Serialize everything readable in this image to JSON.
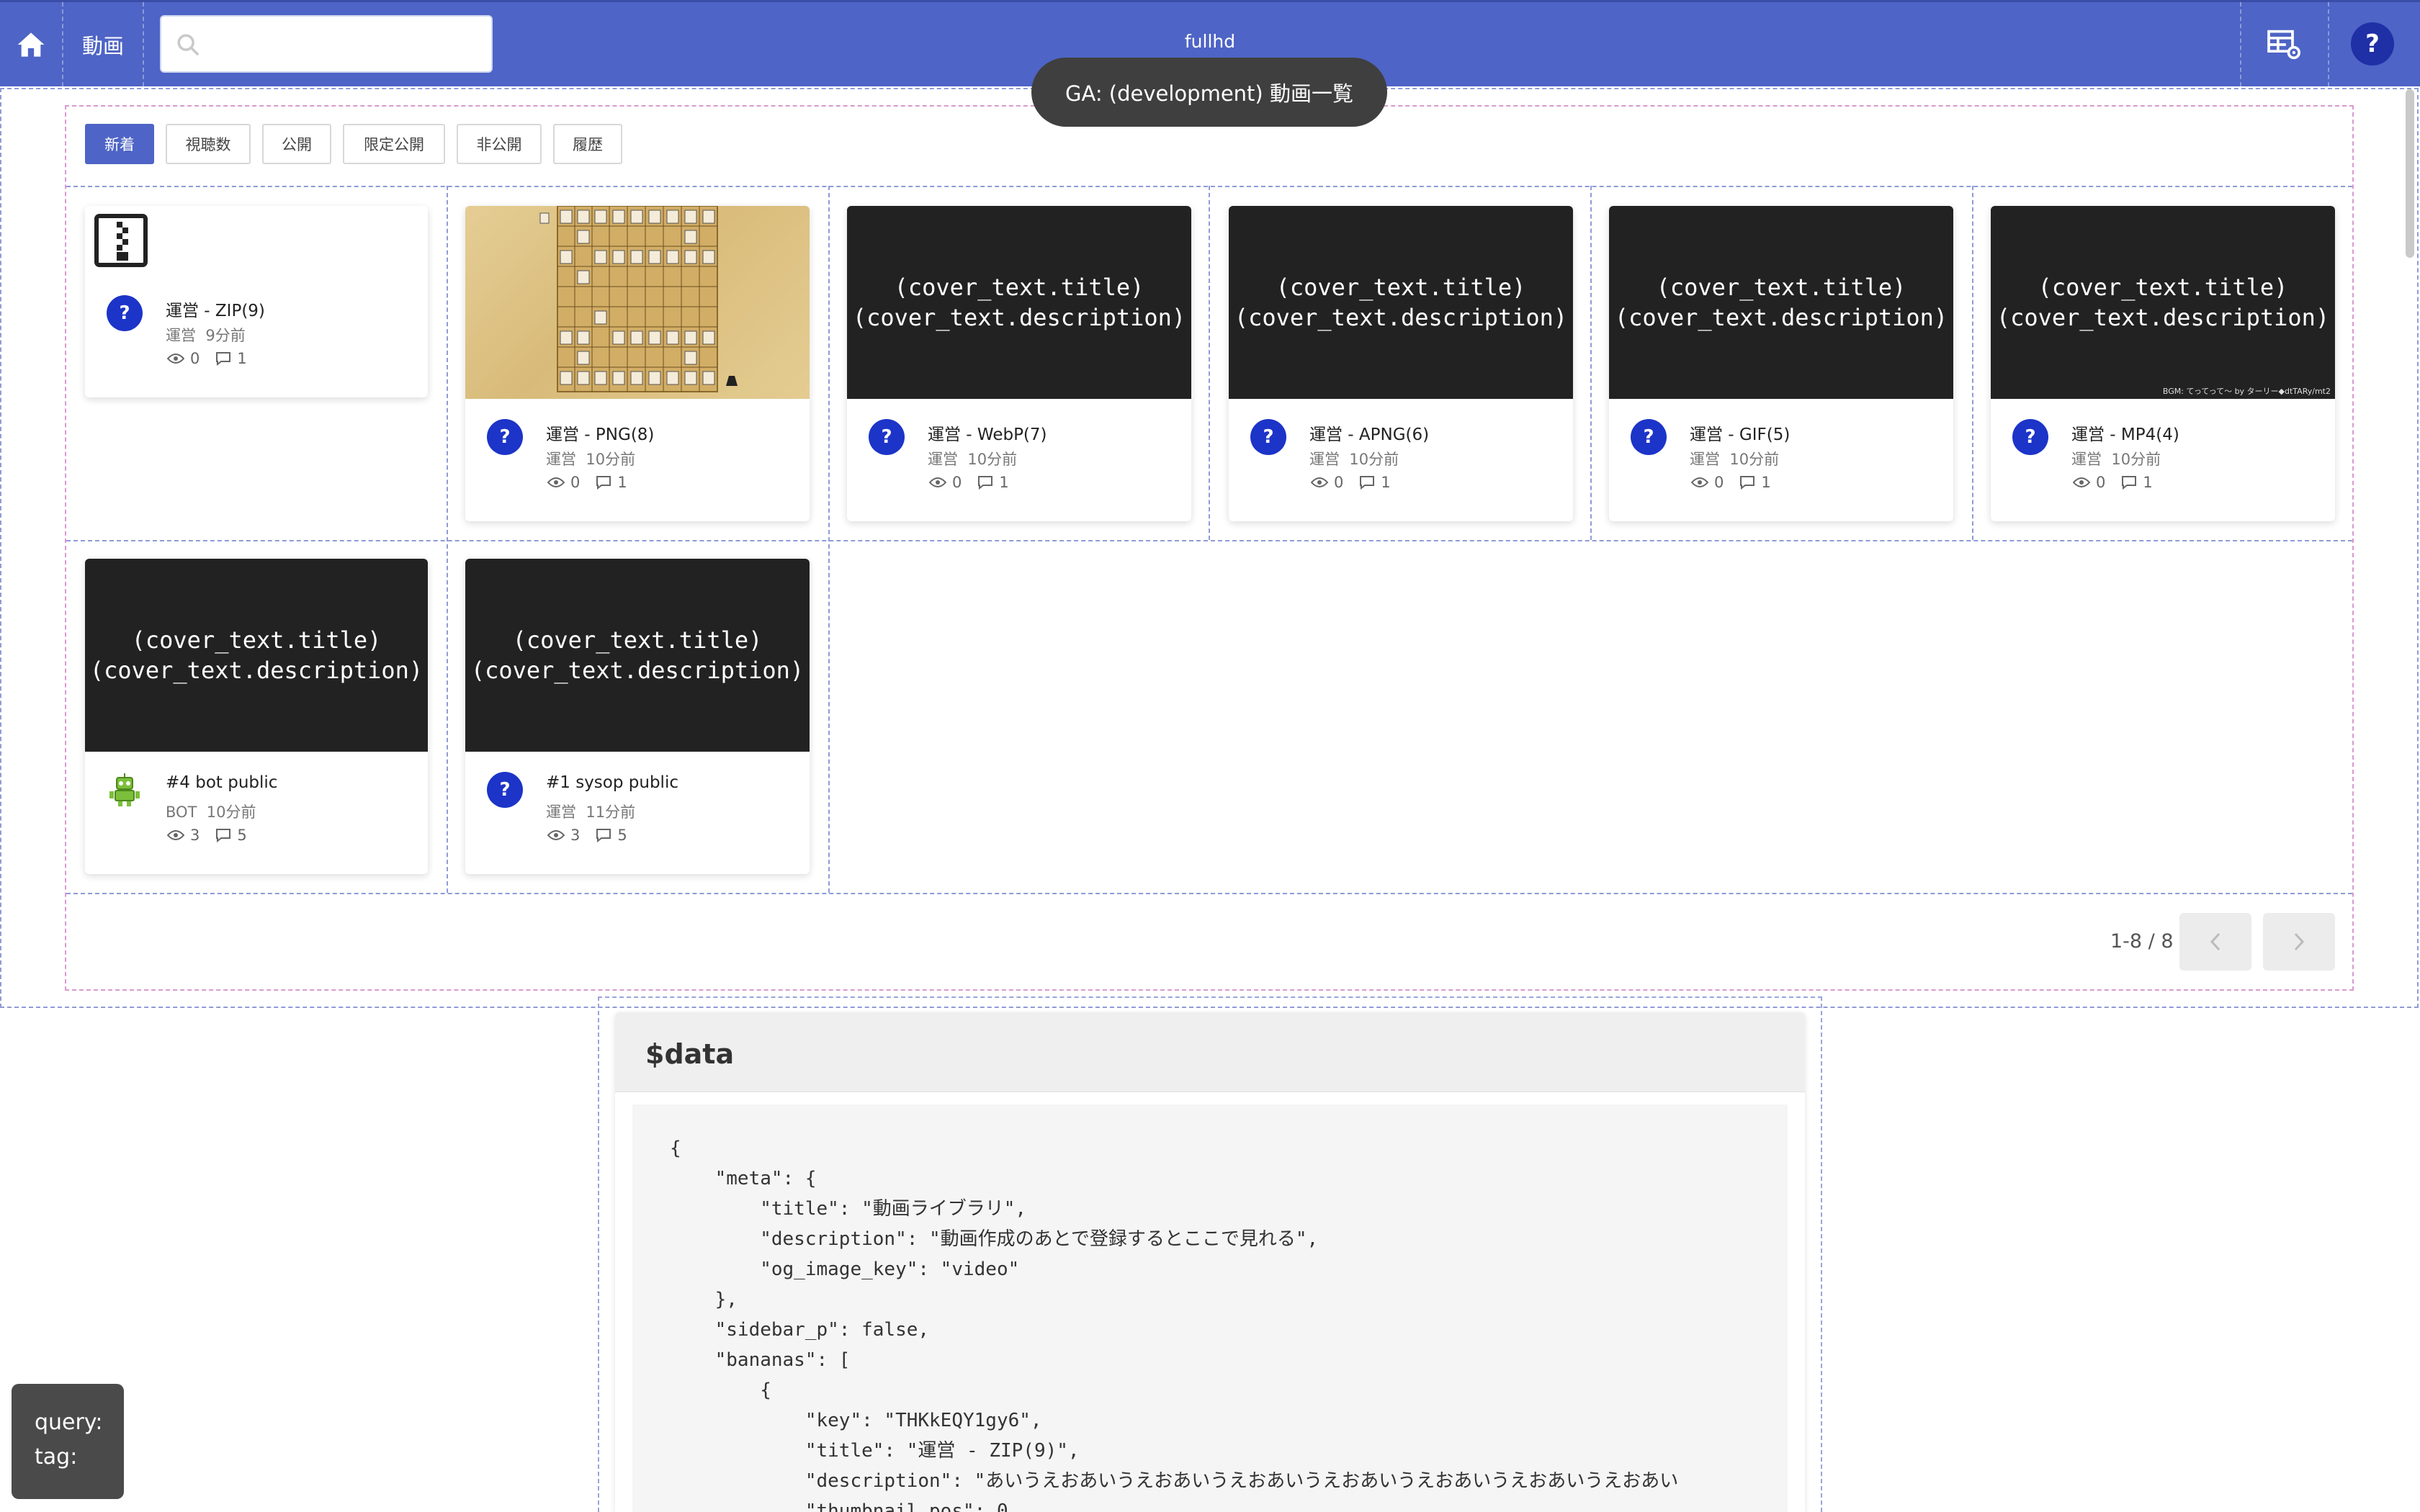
{
  "navbar": {
    "brand": "動画",
    "center_label": "fullhd",
    "search": {
      "value": "",
      "placeholder": ""
    },
    "help_label": "?"
  },
  "toast": {
    "text": "GA: (development) 動画一覧"
  },
  "tabs": [
    {
      "label": "新着",
      "active": true
    },
    {
      "label": "視聴数",
      "active": false
    },
    {
      "label": "公開",
      "active": false
    },
    {
      "label": "限定公開",
      "active": false
    },
    {
      "label": "非公開",
      "active": false
    },
    {
      "label": "履歴",
      "active": false
    }
  ],
  "cards": [
    {
      "thumb": "zip-icon",
      "title": "運営 - ZIP(9)",
      "author": "運営",
      "time": "9分前",
      "views": "0",
      "comments": "1",
      "avatar": "?"
    },
    {
      "thumb": "shogi-board",
      "title": "運営 - PNG(8)",
      "author": "運営",
      "time": "10分前",
      "views": "0",
      "comments": "1",
      "avatar": "?"
    },
    {
      "thumb": "cover",
      "cover_title": "(cover_text.title)",
      "cover_desc": "(cover_text.description)",
      "title": "運営 - WebP(7)",
      "author": "運営",
      "time": "10分前",
      "views": "0",
      "comments": "1",
      "avatar": "?"
    },
    {
      "thumb": "cover",
      "cover_title": "(cover_text.title)",
      "cover_desc": "(cover_text.description)",
      "title": "運営 - APNG(6)",
      "author": "運営",
      "time": "10分前",
      "views": "0",
      "comments": "1",
      "avatar": "?"
    },
    {
      "thumb": "cover",
      "cover_title": "(cover_text.title)",
      "cover_desc": "(cover_text.description)",
      "title": "運営 - GIF(5)",
      "author": "運営",
      "time": "10分前",
      "views": "0",
      "comments": "1",
      "avatar": "?"
    },
    {
      "thumb": "cover",
      "cover_title": "(cover_text.title)",
      "cover_desc": "(cover_text.description)",
      "credit": "BGM: てってって～ by ターリー◆dtTARy/mt2",
      "title": "運営 - MP4(4)",
      "author": "運営",
      "time": "10分前",
      "views": "0",
      "comments": "1",
      "avatar": "?"
    },
    {
      "thumb": "cover",
      "cover_title": "(cover_text.title)",
      "cover_desc": "(cover_text.description)",
      "title": "#4 bot public",
      "author": "BOT",
      "time": "10分前",
      "views": "3",
      "comments": "5",
      "avatar": "robot"
    },
    {
      "thumb": "cover",
      "cover_title": "(cover_text.title)",
      "cover_desc": "(cover_text.description)",
      "title": "#1 sysop public",
      "author": "運営",
      "time": "11分前",
      "views": "3",
      "comments": "5",
      "avatar": "?"
    }
  ],
  "pager": {
    "range": "1-8 / 8"
  },
  "data_panel": {
    "title": "$data",
    "code": "{\n    \"meta\": {\n        \"title\": \"動画ライブラリ\",\n        \"description\": \"動画作成のあとで登録するとここで見れる\",\n        \"og_image_key\": \"video\"\n    },\n    \"sidebar_p\": false,\n    \"bananas\": [\n        {\n            \"key\": \"THKkEQY1gy6\",\n            \"title\": \"運営 - ZIP(9)\",\n            \"description\": \"あいうえおあいうえおあいうえおあいうえおあいうえおあいうえおあいうえおあい\n            \"thumbnail_pos\": 0,"
  },
  "query_box": {
    "query_label": "query:",
    "tag_label": "tag:"
  },
  "colors": {
    "primary": "#4e64c6",
    "avatar": "#1c34c8",
    "thumb_dark": "#222222"
  }
}
